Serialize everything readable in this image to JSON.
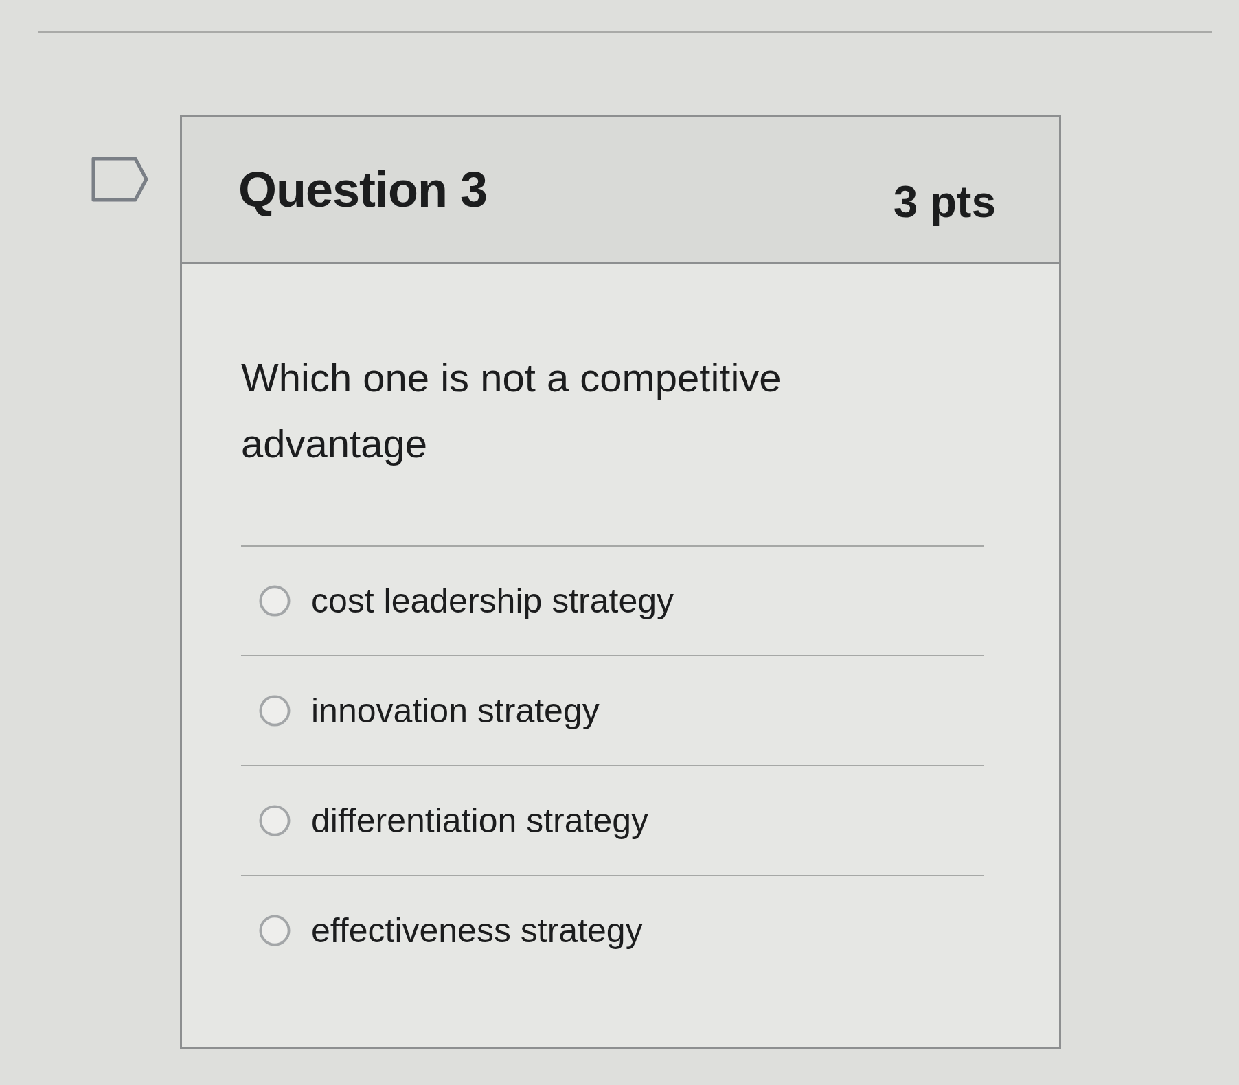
{
  "question": {
    "flagged": false,
    "title": "Question 3",
    "points": "3 pts",
    "text": "Which one is not a competitive advantage"
  },
  "answers": [
    {
      "label": "cost leadership strategy",
      "selected": false
    },
    {
      "label": "innovation strategy",
      "selected": false
    },
    {
      "label": "differentiation strategy",
      "selected": false
    },
    {
      "label": "effectiveness strategy",
      "selected": false
    }
  ]
}
